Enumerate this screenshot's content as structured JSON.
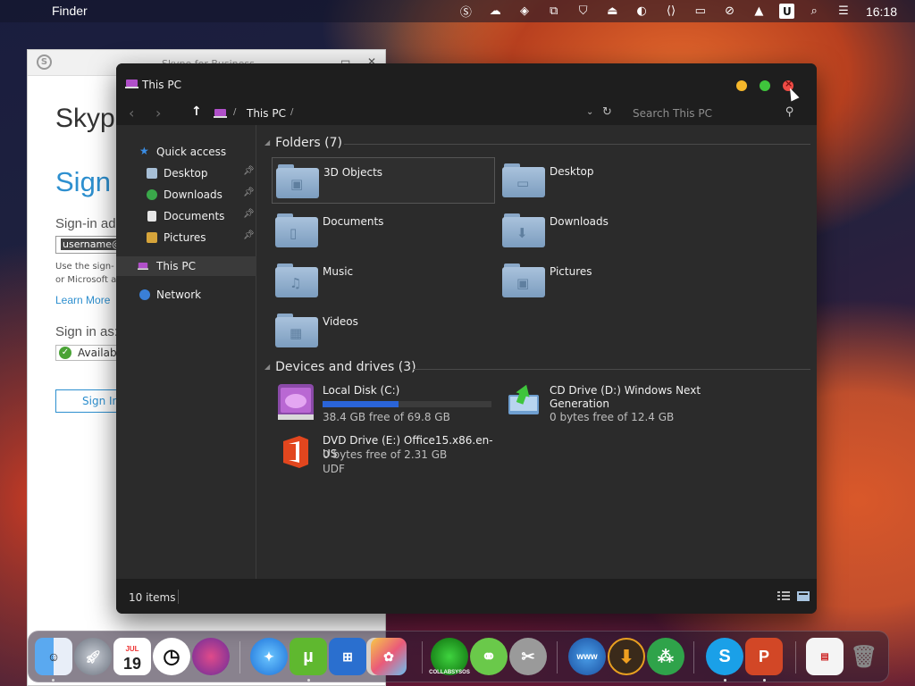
{
  "menubar": {
    "app_name": "Finder",
    "clock": "16:18",
    "tray_icons": [
      "skype-icon",
      "cloud-icon",
      "malwarebytes-icon",
      "network-icon",
      "shield-icon",
      "upload-icon",
      "display-brightness-icon",
      "code-icon",
      "monitor-icon",
      "mute-icon",
      "eject-icon",
      "user-u-icon",
      "search-icon",
      "control-center-icon"
    ]
  },
  "skype": {
    "title": "Skype for Business",
    "heading": "Skype",
    "signin_heading": "Sign i",
    "signin_address_label": "Sign-in ad",
    "username_value": "username@",
    "help_line1": "Use the sign-",
    "help_line2": "or Microsoft a",
    "learn_more": "Learn More",
    "signin_as_label": "Sign in as:",
    "status_value": "Availabl",
    "signin_button": "Sign In"
  },
  "explorer": {
    "title": "This PC",
    "breadcrumb": "This PC",
    "search_placeholder": "Search This PC",
    "sidebar": {
      "quick_access": "Quick access",
      "pinned": [
        {
          "label": "Desktop"
        },
        {
          "label": "Downloads"
        },
        {
          "label": "Documents"
        },
        {
          "label": "Pictures"
        }
      ],
      "this_pc": "This PC",
      "network": "Network"
    },
    "folders_header": "Folders (7)",
    "folders": [
      {
        "name": "3D Objects",
        "glyph": "▣"
      },
      {
        "name": "Desktop",
        "glyph": "▭"
      },
      {
        "name": "Documents",
        "glyph": "▯"
      },
      {
        "name": "Downloads",
        "glyph": "⬇"
      },
      {
        "name": "Music",
        "glyph": "♫"
      },
      {
        "name": "Pictures",
        "glyph": "▣"
      },
      {
        "name": "Videos",
        "glyph": "▦"
      }
    ],
    "drives_header": "Devices and drives (3)",
    "drives": {
      "c": {
        "name": "Local Disk (C:)",
        "free_text": "38.4 GB free of 69.8 GB",
        "used_fraction": 0.45
      },
      "d": {
        "name_line1": "CD Drive (D:) Windows Next",
        "name_line2": "Generation",
        "free_text": "0 bytes free of 12.4 GB"
      },
      "e": {
        "name": "DVD Drive (E:) Office15.x86.en-US",
        "free_text": "0 bytes free of 2.31 GB",
        "fs": "UDF"
      }
    },
    "status_count": "10 items"
  },
  "dock": {
    "items": [
      "Finder",
      "Launchpad",
      "Calendar",
      "Clock",
      "macOS",
      "Safari",
      "uTorrent",
      "Windows",
      "Books",
      "Photos",
      "Collabsysos",
      "Link",
      "Utilities",
      "Globe",
      "Downloader",
      "Network",
      "Skype",
      "PowerPoint",
      "Document",
      "Trash"
    ],
    "calendar_month": "JUL",
    "calendar_day": "19",
    "collab_label": "COLLABSYSOS"
  },
  "colors": {
    "accent_blue": "#2a64d8",
    "skype_blue": "#2d8fcf",
    "traffic_yellow": "#f5b72b",
    "traffic_green": "#3fc53c",
    "traffic_red": "#ef4b45"
  }
}
